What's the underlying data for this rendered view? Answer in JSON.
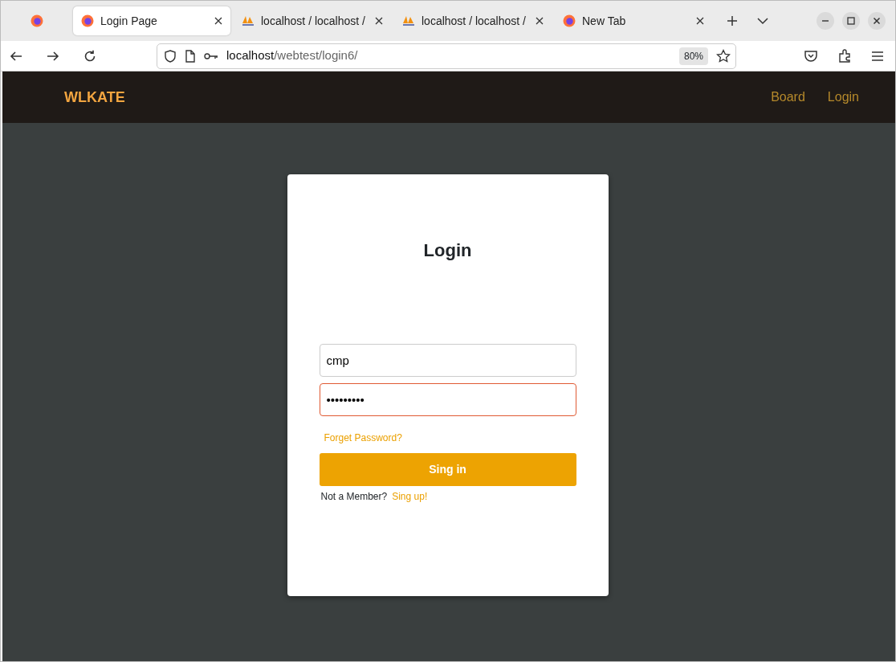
{
  "browser": {
    "tabs": [
      {
        "label": "Login Page",
        "kind": "firefox",
        "selected": true
      },
      {
        "label": "localhost / localhost /",
        "kind": "pma",
        "selected": false
      },
      {
        "label": "localhost / localhost /",
        "kind": "pma",
        "selected": false
      },
      {
        "label": "New Tab",
        "kind": "firefox",
        "selected": false
      }
    ],
    "url_host": "localhost",
    "url_path": "/webtest/login6/",
    "zoom": "80%"
  },
  "navbar": {
    "brand": "WLKATE",
    "links": [
      "Board",
      "Login"
    ]
  },
  "login": {
    "title": "Login",
    "fields": [
      {
        "value": "cmp",
        "focused": false
      },
      {
        "value": "•••••••••",
        "focused": true
      }
    ],
    "forgot": "Forget Password?",
    "submit": "Sing in",
    "signup_text": "Not a Member?",
    "signup_link": "Sing up!"
  }
}
